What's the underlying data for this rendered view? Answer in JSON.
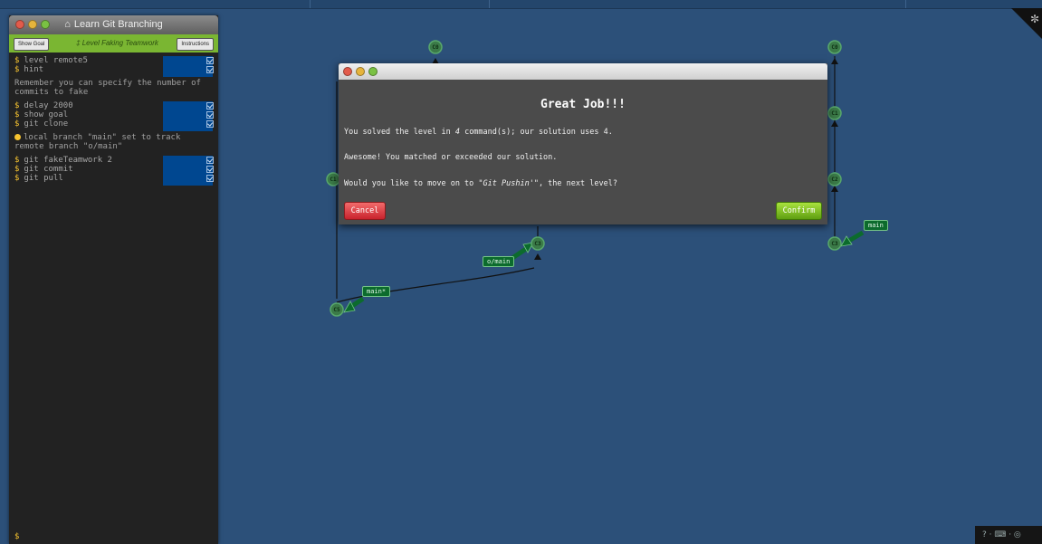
{
  "window": {
    "title": "Learn Git Branching"
  },
  "toolbar": {
    "show_goal": "Show Goal",
    "level_prefix": "Level",
    "level_name": "Faking Teamwork",
    "instructions": "Instructions"
  },
  "terminal": {
    "groups": [
      {
        "commands": [
          "level remote5",
          "hint"
        ]
      },
      {
        "note": "Remember you can specify the number of commits to fake"
      },
      {
        "commands": [
          "delay 2000",
          "show goal",
          "git clone"
        ]
      },
      {
        "note": "local branch \"main\" set to track remote branch \"o/main\"",
        "icon": "warning-icon"
      },
      {
        "commands": [
          "git fakeTeamwork 2",
          "git commit",
          "git pull"
        ]
      }
    ],
    "prompt": "$"
  },
  "graph": {
    "commits": {
      "left_c0": "C0",
      "left_c1": "C1",
      "left_c3": "C3",
      "left_c5": "C5",
      "right_c0": "C0",
      "right_c1": "C1",
      "right_c2": "C2",
      "right_c3": "C3"
    },
    "branches": {
      "left_main": "main*",
      "left_origin_main": "o/main",
      "right_main": "main"
    },
    "colors": {
      "background": "#2c5079",
      "commit_fill": "#3b7a48",
      "branch_fill": "#0c6b2d"
    }
  },
  "modal": {
    "title": "Great Job!!!",
    "line1_pre": "You solved the level in ",
    "line1_num": "4",
    "line1_post": " command(s); our solution uses 4.",
    "line2": "Awesome! You matched or exceeded our solution.",
    "line3_pre": "Would you like to move on to ",
    "line3_level": "\"Git Pushin'\"",
    "line3_post": ", the next level?",
    "cancel": "Cancel",
    "confirm": "Confirm"
  },
  "helpbar": {
    "text": "? · ⌨ · ◎"
  }
}
